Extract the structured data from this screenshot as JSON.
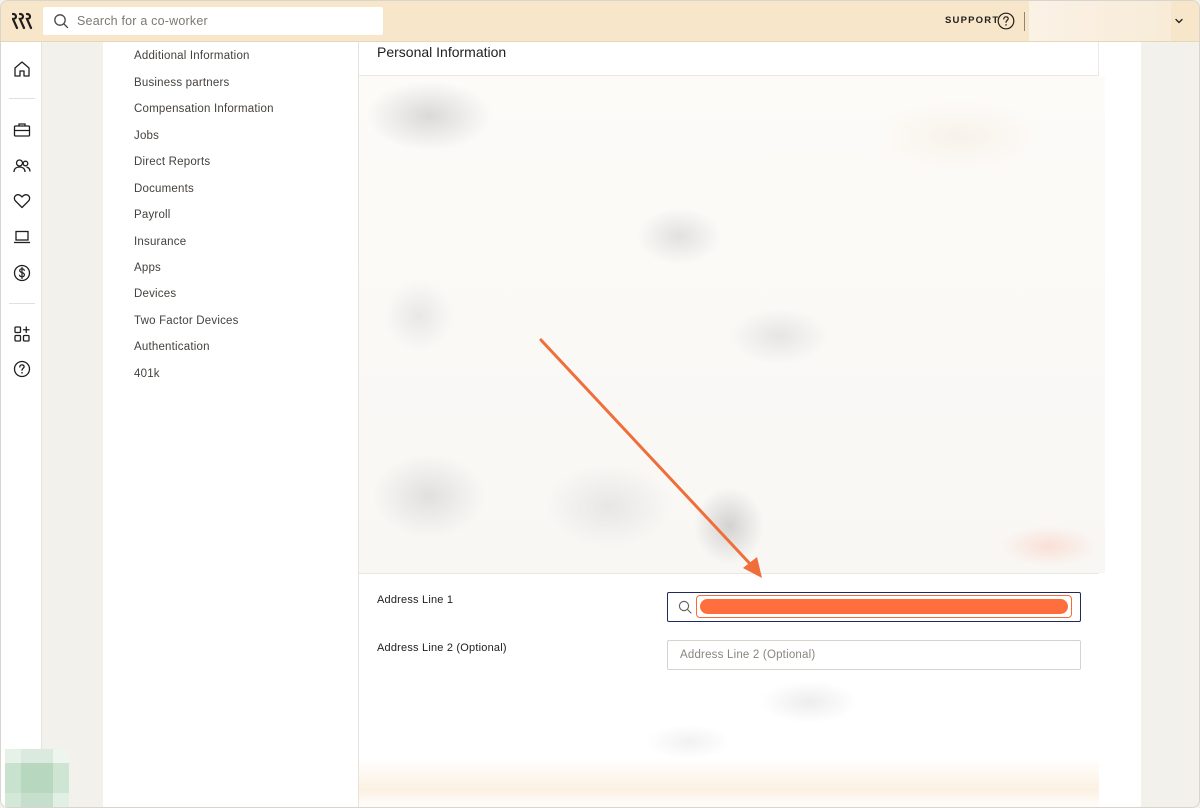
{
  "topbar": {
    "search": {
      "placeholder": "Search for a co-worker",
      "value": ""
    },
    "support_label": "SUPPORT"
  },
  "rail": {
    "icons": [
      "home-icon",
      "briefcase-icon",
      "people-icon",
      "heart-icon",
      "laptop-icon",
      "dollar-icon",
      "apps-add-icon",
      "help-icon"
    ]
  },
  "subnav": {
    "items": [
      {
        "label": "Additional Information"
      },
      {
        "label": "Business partners"
      },
      {
        "label": "Compensation Information"
      },
      {
        "label": "Jobs"
      },
      {
        "label": "Direct Reports"
      },
      {
        "label": "Documents"
      },
      {
        "label": "Payroll"
      },
      {
        "label": "Insurance"
      },
      {
        "label": "Apps"
      },
      {
        "label": "Devices"
      },
      {
        "label": "Two Factor Devices"
      },
      {
        "label": "Authentication"
      },
      {
        "label": "401k"
      }
    ]
  },
  "panel": {
    "title": "Personal Information",
    "address_line_1": {
      "label": "Address Line 1",
      "value": ""
    },
    "address_line_2": {
      "label": "Address Line 2 (Optional)",
      "placeholder": "Address Line 2 (Optional)",
      "value": ""
    }
  },
  "colors": {
    "topbar_bg": "#f7e6c9",
    "accent_arrow": "#ef6e3a",
    "redaction": "#ff6f3d",
    "focus_border": "#1f2a5c"
  }
}
